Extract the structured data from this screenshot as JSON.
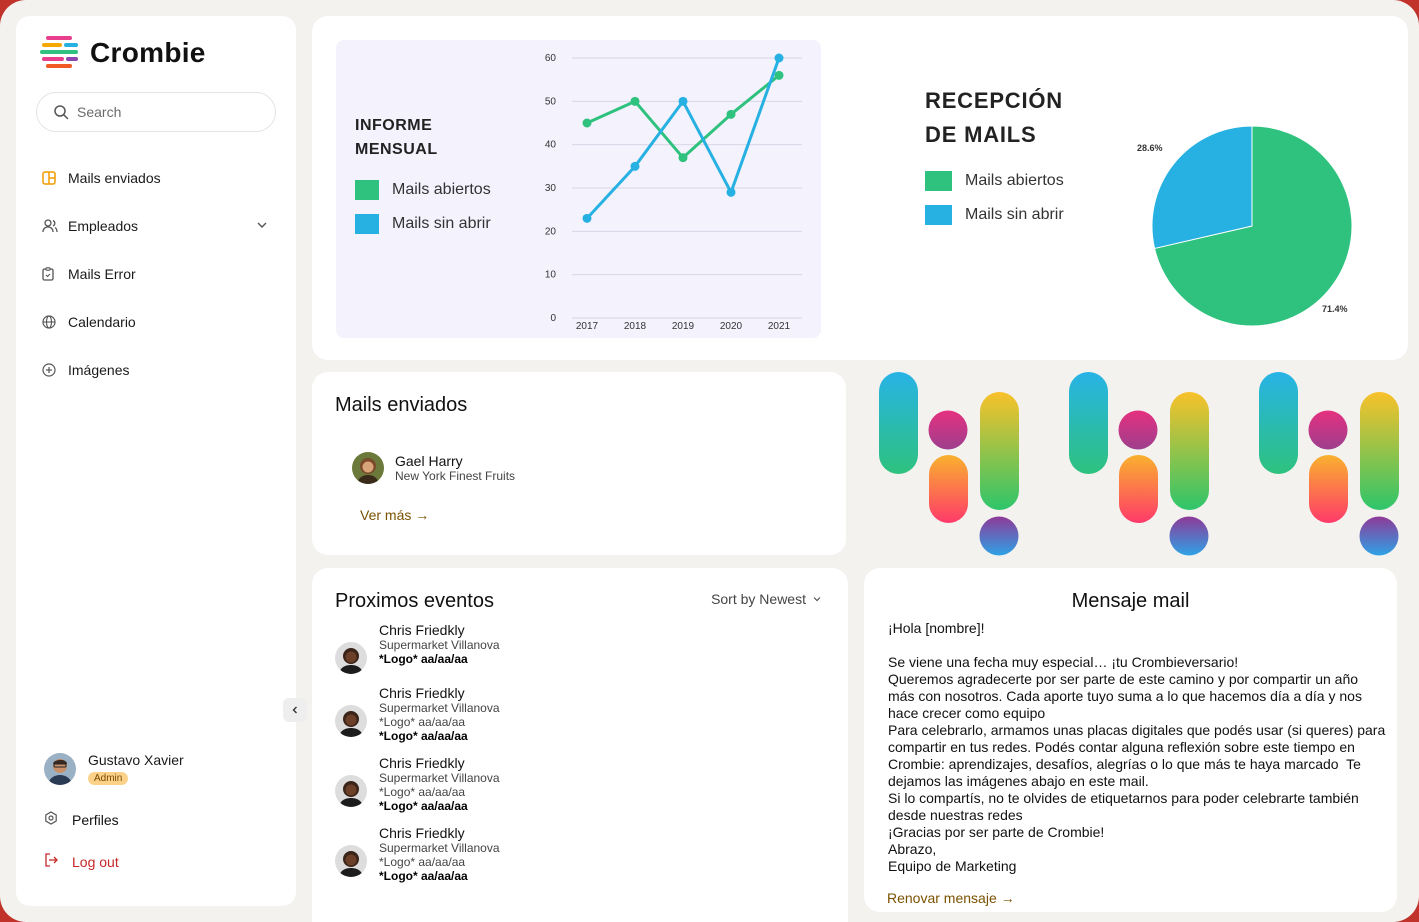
{
  "brand": {
    "name": "Crombie"
  },
  "search": {
    "placeholder": "Search"
  },
  "sidebar": {
    "items": [
      {
        "label": "Mails enviados",
        "icon": "mail-layout-icon"
      },
      {
        "label": "Empleados",
        "icon": "users-icon"
      },
      {
        "label": "Mails Error",
        "icon": "clipboard-icon"
      },
      {
        "label": "Calendario",
        "icon": "globe-icon"
      },
      {
        "label": "Imágenes",
        "icon": "plus-circle-icon"
      }
    ],
    "user": {
      "name": "Gustavo Xavier",
      "role": "Admin"
    },
    "profiles_label": "Perfiles",
    "logout_label": "Log out"
  },
  "colors": {
    "green": "#2ec27e",
    "blue": "#26b1e2",
    "accent_link": "#7a5200",
    "logout": "#c62828"
  },
  "line_chart": {
    "title_line1": "INFORME",
    "title_line2": "MENSUAL",
    "legend": [
      "Mails abiertos",
      "Mails sin abrir"
    ]
  },
  "pie_chart": {
    "title_line1": "RECEPCIÓN",
    "title_line2": "DE MAILS",
    "legend": [
      "Mails abiertos",
      "Mails sin abrir"
    ],
    "label_small": "28.6%",
    "label_large": "71.4%"
  },
  "chart_data": [
    {
      "type": "line",
      "x": [
        "2017",
        "2018",
        "2019",
        "2020",
        "2021"
      ],
      "series": [
        {
          "name": "Mails abiertos",
          "values": [
            45,
            50,
            37,
            47,
            56
          ],
          "color": "#2ec27e"
        },
        {
          "name": "Mails sin abrir",
          "values": [
            23,
            35,
            50,
            29,
            60
          ],
          "color": "#26b1e2"
        }
      ],
      "ylim": [
        0,
        60
      ],
      "yticks": [
        "0",
        "10",
        "20",
        "30",
        "40",
        "50",
        "60"
      ],
      "grid": true
    },
    {
      "type": "pie",
      "labels": [
        "Mails abiertos",
        "Mails sin abrir"
      ],
      "values": [
        71.4,
        28.6
      ],
      "colors": [
        "#2ec27e",
        "#26b1e2"
      ]
    }
  ],
  "mails_enviados": {
    "title": "Mails enviados",
    "entry": {
      "name": "Gael Harry",
      "company": "New York Finest Fruits"
    },
    "more_label": "Ver más →"
  },
  "eventos": {
    "title": "Proximos eventos",
    "sort_label": "Sort by Newest",
    "items": [
      {
        "name": "Chris Friedkly",
        "place": "Supermarket Villanova",
        "logo": "",
        "bold": "*Logo* aa/aa/aa"
      },
      {
        "name": "Chris Friedkly",
        "place": "Supermarket Villanova",
        "logo": "*Logo* aa/aa/aa",
        "bold": "*Logo* aa/aa/aa"
      },
      {
        "name": "Chris Friedkly",
        "place": "Supermarket Villanova",
        "logo": "*Logo* aa/aa/aa",
        "bold": "*Logo* aa/aa/aa"
      },
      {
        "name": "Chris Friedkly",
        "place": "Supermarket Villanova",
        "logo": "*Logo* aa/aa/aa",
        "bold": "*Logo* aa/aa/aa"
      }
    ]
  },
  "mensaje": {
    "title": "Mensaje mail",
    "body": "¡Hola [nombre]!\n\nSe viene una fecha muy especial… ¡tu Crombieversario!\nQueremos agradecerte por ser parte de este camino y por compartir un año más con nosotros. Cada aporte tuyo suma a lo que hacemos día a día y nos hace crecer como equipo\nPara celebrarlo, armamos unas placas digitales que podés usar (si queres) para compartir en tus redes. Podés contar alguna reflexión sobre este tiempo en Crombie: aprendizajes, desafíos, alegrías o lo que más te haya marcado  Te dejamos las imágenes abajo en este mail.\nSi lo compartís, no te olvides de etiquetarnos para poder celebrarte también desde nuestras redes\n¡Gracias por ser parte de Crombie!\nAbrazo,\nEquipo de Marketing",
    "renew_label": "Renovar mensaje →"
  }
}
